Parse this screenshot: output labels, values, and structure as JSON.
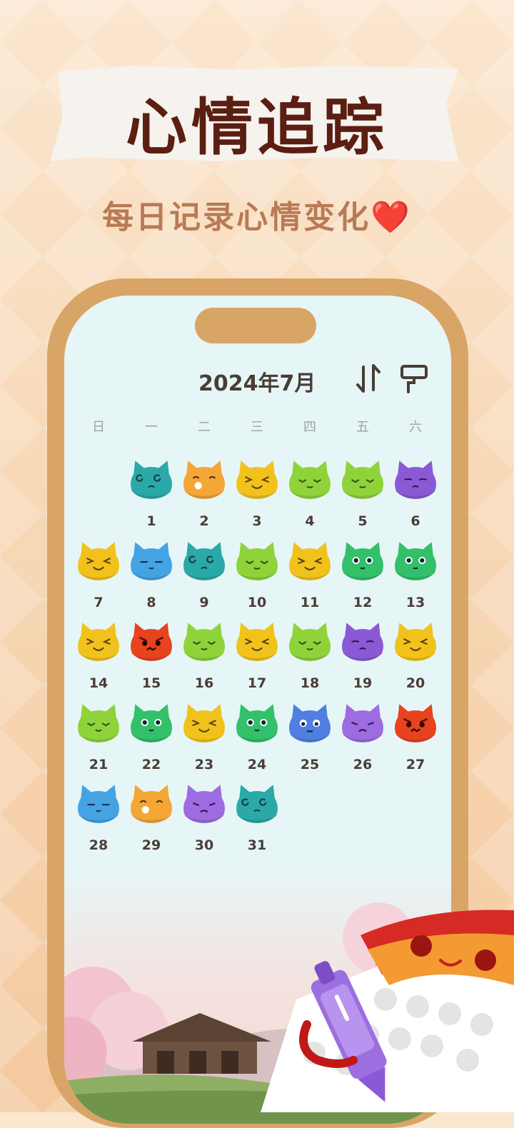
{
  "header": {
    "title": "心情追踪",
    "subtitle": "每日记录心情变化",
    "subtitle_emoji": "❤️"
  },
  "calendar": {
    "month_label": "2024年7月",
    "weekdays": [
      "日",
      "一",
      "二",
      "三",
      "四",
      "五",
      "六"
    ],
    "start_weekday": 1,
    "icons": {
      "sort": "sort-arrows-icon",
      "theme": "paint-roller-icon"
    },
    "days": [
      {
        "day": "1",
        "mood": "dizzy",
        "color": "#2aa9a8"
      },
      {
        "day": "2",
        "mood": "eating",
        "color": "#f4a636"
      },
      {
        "day": "3",
        "mood": "laughing",
        "color": "#f2c21c"
      },
      {
        "day": "4",
        "mood": "content",
        "color": "#8fd33a"
      },
      {
        "day": "5",
        "mood": "content",
        "color": "#8fd33a"
      },
      {
        "day": "6",
        "mood": "sad",
        "color": "#8a5ad6"
      },
      {
        "day": "7",
        "mood": "laughing",
        "color": "#f2c21c"
      },
      {
        "day": "8",
        "mood": "calm",
        "color": "#45a3e3"
      },
      {
        "day": "9",
        "mood": "dizzy",
        "color": "#2aa9a8"
      },
      {
        "day": "10",
        "mood": "content",
        "color": "#8fd33a"
      },
      {
        "day": "11",
        "mood": "laughing",
        "color": "#f2c21c"
      },
      {
        "day": "12",
        "mood": "neutral",
        "color": "#33c06a"
      },
      {
        "day": "13",
        "mood": "neutral",
        "color": "#33c06a"
      },
      {
        "day": "14",
        "mood": "laughing",
        "color": "#f2c21c"
      },
      {
        "day": "15",
        "mood": "angry",
        "color": "#e8431f"
      },
      {
        "day": "16",
        "mood": "content",
        "color": "#8fd33a"
      },
      {
        "day": "17",
        "mood": "laughing",
        "color": "#f2c21c"
      },
      {
        "day": "18",
        "mood": "content",
        "color": "#8fd33a"
      },
      {
        "day": "19",
        "mood": "sad",
        "color": "#8a5ad6"
      },
      {
        "day": "20",
        "mood": "laughing",
        "color": "#f2c21c"
      },
      {
        "day": "21",
        "mood": "content",
        "color": "#8fd33a"
      },
      {
        "day": "22",
        "mood": "neutral",
        "color": "#33c06a"
      },
      {
        "day": "23",
        "mood": "laughing",
        "color": "#f2c21c"
      },
      {
        "day": "24",
        "mood": "neutral",
        "color": "#33c06a"
      },
      {
        "day": "25",
        "mood": "worried",
        "color": "#4f7fe0"
      },
      {
        "day": "26",
        "mood": "upset",
        "color": "#9e6be0"
      },
      {
        "day": "27",
        "mood": "angry",
        "color": "#e8431f"
      },
      {
        "day": "28",
        "mood": "calm",
        "color": "#45a3e3"
      },
      {
        "day": "29",
        "mood": "eating",
        "color": "#f4a636"
      },
      {
        "day": "30",
        "mood": "upset",
        "color": "#9e6be0"
      },
      {
        "day": "31",
        "mood": "dizzy",
        "color": "#2aa9a8"
      }
    ]
  }
}
